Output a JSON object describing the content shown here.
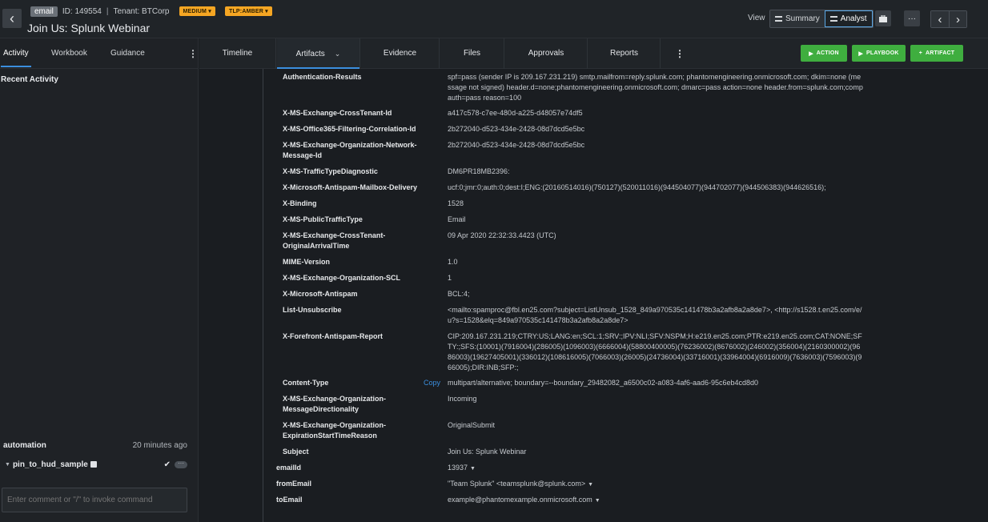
{
  "header": {
    "type_badge": "email",
    "id_label": "ID: 149554",
    "separator": "|",
    "tenant_label": "Tenant: BTCorp",
    "severity": "MEDIUM",
    "tlp": "TLP:AMBER",
    "title": "Join Us: Splunk Webinar",
    "view_label": "View",
    "view_summary": "Summary",
    "view_analyst": "Analyst",
    "back_glyph": "‹",
    "prev_glyph": "‹",
    "next_glyph": "›",
    "more_glyph": "···",
    "icons": [
      "back-icon",
      "briefcase-icon",
      "more-icon",
      "chevron-left-icon",
      "chevron-right-icon"
    ]
  },
  "left_panel": {
    "tabs": [
      "Activity",
      "Workbook",
      "Guidance"
    ],
    "recent_activity": "Recent Activity",
    "automation": {
      "name": "automation",
      "time": "20 minutes ago",
      "playbook": "pin_to_hud_sample"
    },
    "comment_placeholder": "Enter comment or \"/\" to invoke command"
  },
  "main_tabs": {
    "tabs": [
      "Timeline",
      "Artifacts",
      "Evidence",
      "Files",
      "Approvals",
      "Reports"
    ],
    "actions": {
      "action": "ACTION",
      "playbook": "PLAYBOOK",
      "artifact": "ARTIFACT"
    },
    "colors": {
      "action_green": "#3fae3f",
      "accent_blue": "#3b8ede",
      "badge_amber": "#f5a623"
    }
  },
  "artifact": {
    "copy_label": "Copy",
    "headers": [
      {
        "key": "Authentication-Results",
        "value": "spf=pass (sender IP is 209.167.231.219) smtp.mailfrom=reply.splunk.com; phantomengineering.onmicrosoft.com; dkim=none (message not signed) header.d=none;phantomengineering.onmicrosoft.com; dmarc=pass action=none header.from=splunk.com;compauth=pass reason=100"
      },
      {
        "key": "X-MS-Exchange-CrossTenant-Id",
        "value": "a417c578-c7ee-480d-a225-d48057e74df5"
      },
      {
        "key": "X-MS-Office365-Filtering-Correlation-Id",
        "value": "2b272040-d523-434e-2428-08d7dcd5e5bc"
      },
      {
        "key": "X-MS-Exchange-Organization-Network-Message-Id",
        "value": "2b272040-d523-434e-2428-08d7dcd5e5bc"
      },
      {
        "key": "X-MS-TrafficTypeDiagnostic",
        "value": "DM6PR18MB2396:"
      },
      {
        "key": "X-Microsoft-Antispam-Mailbox-Delivery",
        "value": "ucf:0;jmr:0;auth:0;dest:I;ENG:(20160514016)(750127)(520011016)(944504077)(944702077)(944506383)(944626516);"
      },
      {
        "key": "X-Binding",
        "value": "1528"
      },
      {
        "key": "X-MS-PublicTrafficType",
        "value": "Email"
      },
      {
        "key": "X-MS-Exchange-CrossTenant-OriginalArrivalTime",
        "value": "09 Apr 2020 22:32:33.4423 (UTC)"
      },
      {
        "key": "MIME-Version",
        "value": "1.0"
      },
      {
        "key": "X-MS-Exchange-Organization-SCL",
        "value": "1"
      },
      {
        "key": "X-Microsoft-Antispam",
        "value": "BCL:4;"
      },
      {
        "key": "List-Unsubscribe",
        "value": "<mailto:spamproc@fbl.en25.com?subject=ListUnsub_1528_849a970535c141478b3a2afb8a2a8de7>, <http://s1528.t.en25.com/e/u?s=1528&elq=849a970535c141478b3a2afb8a2a8de7>"
      },
      {
        "key": "X-Forefront-Antispam-Report",
        "value": "CIP:209.167.231.219;CTRY:US;LANG:en;SCL:1;SRV:;IPV:NLI;SFV:NSPM;H:e219.en25.com;PTR:e219.en25.com;CAT:NONE;SFTY:;SFS:(10001)(7916004)(286005)(1096003)(6666004)(58800400005)(76236002)(8676002)(246002)(356004)(2160300002)(9686003)(19627405001)(336012)(108616005)(7066003)(26005)(24736004)(33716001)(33964004)(6916009)(7636003)(7596003)(966005);DIR:INB;SFP:;"
      },
      {
        "key": "Content-Type",
        "value": "multipart/alternative; boundary=--boundary_29482082_a6500c02-a083-4af6-aad6-95c6eb4cd8d0"
      },
      {
        "key": "X-MS-Exchange-Organization-MessageDirectionality",
        "value": "Incoming"
      },
      {
        "key": "X-MS-Exchange-Organization-ExpirationStartTimeReason",
        "value": "OriginalSubmit"
      },
      {
        "key": "Subject",
        "value": "Join Us: Splunk Webinar"
      }
    ],
    "fields": [
      {
        "key": "emailId",
        "value": "13937"
      },
      {
        "key": "fromEmail",
        "value": "\"Team Splunk\" <teamsplunk@splunk.com>"
      },
      {
        "key": "toEmail",
        "value": "example@phantomexample.onmicrosoft.com"
      }
    ]
  }
}
